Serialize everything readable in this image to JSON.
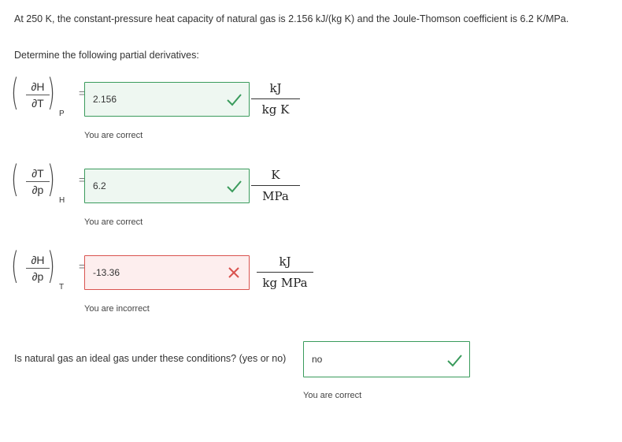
{
  "problem_text": "At 250 K, the constant-pressure heat capacity of natural gas is 2.156 kJ/(kg K) and the Joule-Thomson coefficient is 6.2 K/MPa.",
  "instruction": "Determine the following partial derivatives:",
  "derivatives": [
    {
      "numerator": "∂H",
      "denominator": "∂T",
      "subscript": "P",
      "equals": "=",
      "value": "2.156",
      "status": "correct",
      "unit_num": "kJ",
      "unit_den": "kg K",
      "feedback": "You are correct"
    },
    {
      "numerator": "∂T",
      "denominator": "∂p",
      "subscript": "H",
      "equals": "=",
      "value": "6.2",
      "status": "correct",
      "unit_num": "K",
      "unit_den": "MPa",
      "feedback": "You are correct"
    },
    {
      "numerator": "∂H",
      "denominator": "∂p",
      "subscript": "T",
      "equals": "=",
      "value": "-13.36",
      "status": "incorrect",
      "unit_num": "kJ",
      "unit_den": "kg MPa",
      "feedback": "You are incorrect"
    }
  ],
  "ideal_gas_question": {
    "label": "Is natural gas an ideal gas under these conditions? (yes or no)",
    "value": "no",
    "status": "correct",
    "feedback": "You are correct"
  },
  "colors": {
    "correct": "#3a9b5c",
    "incorrect": "#d9534f"
  },
  "icons": {
    "correct": "check-icon",
    "incorrect": "cross-icon"
  }
}
